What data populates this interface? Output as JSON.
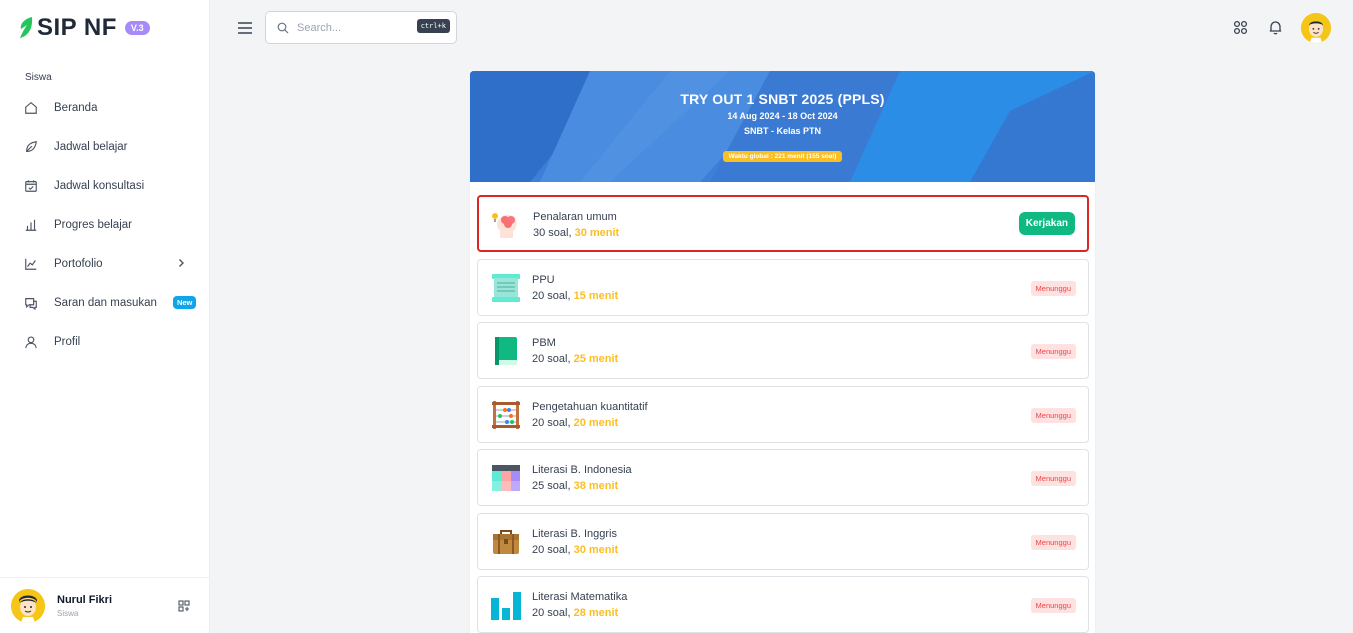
{
  "app": {
    "name": "SIP NF",
    "version": "V.3"
  },
  "sidebar": {
    "section": "Siswa",
    "items": [
      {
        "label": "Beranda",
        "icon": "home-icon"
      },
      {
        "label": "Jadwal belajar",
        "icon": "leaf-icon"
      },
      {
        "label": "Jadwal konsultasi",
        "icon": "calendar-check-icon"
      },
      {
        "label": "Progres belajar",
        "icon": "bar-chart-icon"
      },
      {
        "label": "Portofolio",
        "icon": "line-chart-icon"
      },
      {
        "label": "Saran dan masukan",
        "icon": "chat-icon",
        "badge": "New"
      },
      {
        "label": "Profil",
        "icon": "user-icon"
      }
    ]
  },
  "user": {
    "name": "Nurul Fikri",
    "role": "Siswa"
  },
  "search": {
    "placeholder": "Search...",
    "shortcut": "ctrl+k"
  },
  "tryout": {
    "title": "TRY OUT 1 SNBT 2025 (PPLS)",
    "dates": "14 Aug 2024 - 18 Oct 2024",
    "class": "SNBT - Kelas PTN",
    "global_time": "Waktu global : 221 menit (155 soal)"
  },
  "subjects": [
    {
      "name": "Penalaran umum",
      "count": "30 soal,",
      "duration": "30 menit",
      "action": "Kerjakan",
      "icon": "brain-icon"
    },
    {
      "name": "PPU",
      "count": "20 soal,",
      "duration": "15 menit",
      "status": "Menunggu",
      "icon": "scroll-icon"
    },
    {
      "name": "PBM",
      "count": "20 soal,",
      "duration": "25 menit",
      "status": "Menunggu",
      "icon": "book-icon"
    },
    {
      "name": "Pengetahuan kuantitatif",
      "count": "20 soal,",
      "duration": "20 menit",
      "status": "Menunggu",
      "icon": "abacus-icon"
    },
    {
      "name": "Literasi B. Indonesia",
      "count": "25 soal,",
      "duration": "38 menit",
      "status": "Menunggu",
      "icon": "palette-icon"
    },
    {
      "name": "Literasi B. Inggris",
      "count": "20 soal,",
      "duration": "30 menit",
      "status": "Menunggu",
      "icon": "briefcase-icon"
    },
    {
      "name": "Literasi Matematika",
      "count": "20 soal,",
      "duration": "28 menit",
      "status": "Menunggu",
      "icon": "bars-icon"
    }
  ],
  "colors": {
    "accent_green": "#10b981",
    "duration_yellow": "#fbbf24",
    "banner_blue": "#3b82d9",
    "status_red": "#ef4444"
  }
}
